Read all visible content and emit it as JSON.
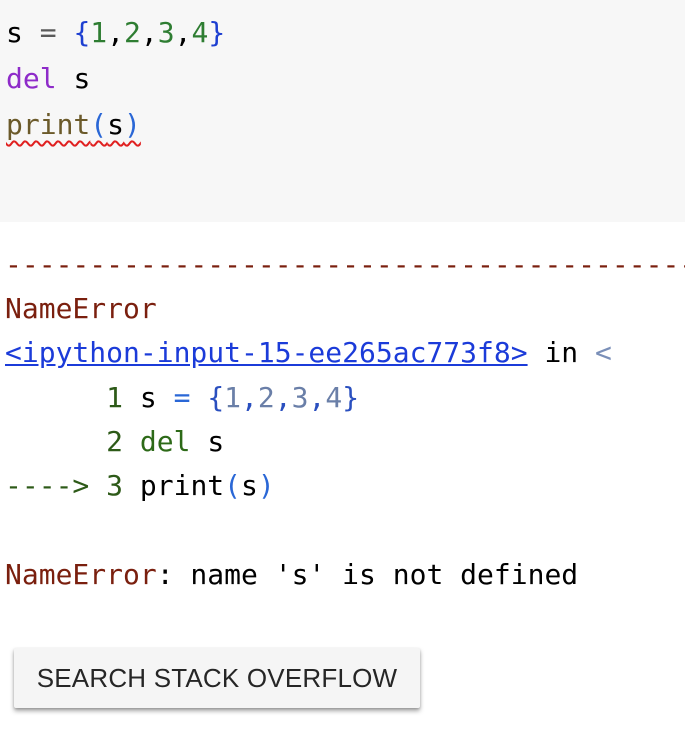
{
  "code_cell": {
    "lines": [
      {
        "var": "s",
        "op": "=",
        "open": "{",
        "n1": "1",
        "c1": ",",
        "n2": "2",
        "c2": ",",
        "n3": "3",
        "c3": ",",
        "n4": "4",
        "close": "}"
      },
      {
        "keyword": "del",
        "name": "s"
      },
      {
        "func": "print",
        "open": "(",
        "arg": "s",
        "close": ")"
      }
    ]
  },
  "output": {
    "separator": "---------------------------------------------------------------------------",
    "error_type": "NameError",
    "traceback_link": "<ipython-input-15-ee265ac773f8>",
    "traceback_in": "in",
    "traceback_more": "<",
    "tb_lines": [
      {
        "prefix": "      ",
        "lineno": "1",
        "code_var": "s",
        "code_op": "=",
        "code_open": "{",
        "code_n1": "1",
        "code_c1": ",",
        "code_n2": "2",
        "code_c2": ",",
        "code_n3": "3",
        "code_c3": ",",
        "code_n4": "4",
        "code_close": "}"
      },
      {
        "prefix": "      ",
        "lineno": "2",
        "code_kw": "del",
        "code_name": "s"
      },
      {
        "prefix": "---->",
        "lineno": "3",
        "code_func": "print",
        "code_open": "(",
        "code_arg": "s",
        "code_close": ")"
      }
    ],
    "final_error_type": "NameError",
    "final_error_message": ": name 's' is not defined"
  },
  "search_button": {
    "label": "SEARCH STACK OVERFLOW"
  }
}
